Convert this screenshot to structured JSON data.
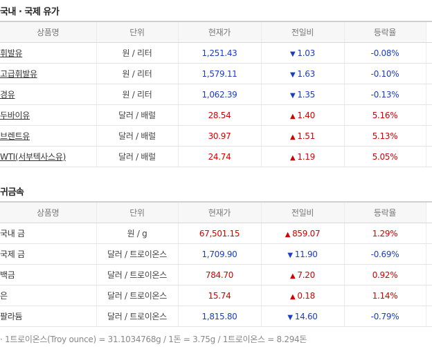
{
  "oil": {
    "title": "국내 · 국제 유가",
    "headers": [
      "상품명",
      "단위",
      "현재가",
      "전일비",
      "등락율"
    ],
    "rows": [
      {
        "name": "휘발유",
        "unit": "원 / 리터",
        "price": "1,251.43",
        "change": "1.03",
        "dir": "down",
        "rate": "-0.08%"
      },
      {
        "name": "고급휘발유",
        "unit": "원 / 리터",
        "price": "1,579.11",
        "change": "1.63",
        "dir": "down",
        "rate": "-0.10%"
      },
      {
        "name": "경유",
        "unit": "원 / 리터",
        "price": "1,062.39",
        "change": "1.35",
        "dir": "down",
        "rate": "-0.13%"
      },
      {
        "name": "두바이유",
        "unit": "달러 / 배럴",
        "price": "28.54",
        "change": "1.40",
        "dir": "up",
        "rate": "5.16%"
      },
      {
        "name": "브렌트유",
        "unit": "달러 / 배럴",
        "price": "30.97",
        "change": "1.51",
        "dir": "up",
        "rate": "5.13%"
      },
      {
        "name": "WTI(서부텍사스유)",
        "unit": "달러 / 배럴",
        "price": "24.74",
        "change": "1.19",
        "dir": "up",
        "rate": "5.05%"
      }
    ]
  },
  "metal": {
    "title": "귀금속",
    "headers": [
      "상품명",
      "단위",
      "현재가",
      "전일비",
      "등락율"
    ],
    "rows": [
      {
        "name": "국내 금",
        "unit": "원 / g",
        "price": "67,501.15",
        "change": "859.07",
        "dir": "up",
        "rate": "1.29%"
      },
      {
        "name": "국제 금",
        "unit": "달러 / 트로이온스",
        "price": "1,709.90",
        "change": "11.90",
        "dir": "down",
        "rate": "-0.69%"
      },
      {
        "name": "백금",
        "unit": "달러 / 트로이온스",
        "price": "784.70",
        "change": "7.20",
        "dir": "up",
        "rate": "0.92%"
      },
      {
        "name": "은",
        "unit": "달러 / 트로이온스",
        "price": "15.74",
        "change": "0.18",
        "dir": "up",
        "rate": "1.14%"
      },
      {
        "name": "팔라듐",
        "unit": "달러 / 트로이온스",
        "price": "1,815.80",
        "change": "14.60",
        "dir": "down",
        "rate": "-0.79%"
      }
    ]
  },
  "footnote": "· 1트로이온스(Troy ounce) = 31.1034768g / 1돈 = 3.75g / 1트로이온스 = 8.294돈",
  "colors": {
    "up": "#d20000",
    "down": "#1a3dc1"
  },
  "icons": {
    "up": "triangle-up-icon",
    "down": "triangle-down-icon"
  }
}
